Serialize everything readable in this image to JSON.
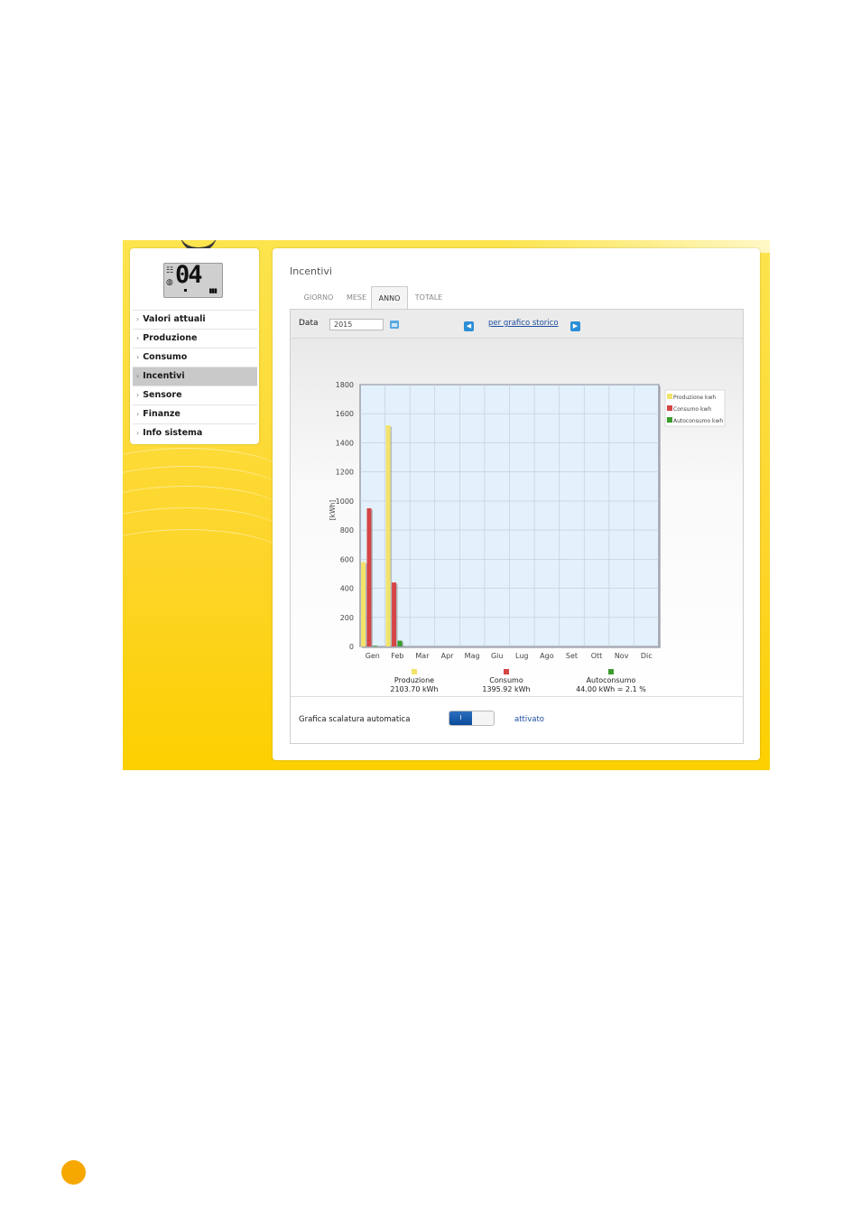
{
  "sidebar": {
    "display": {
      "digits": "04",
      "glyph_top": "☷",
      "glyph_bottom": "◍",
      "bars": "▮▮▮"
    },
    "items": [
      {
        "label": "Valori attuali",
        "active": false
      },
      {
        "label": "Produzione",
        "active": false
      },
      {
        "label": "Consumo",
        "active": false
      },
      {
        "label": "Incentivi",
        "active": true
      },
      {
        "label": "Sensore",
        "active": false
      },
      {
        "label": "Finanze",
        "active": false
      },
      {
        "label": "Info sistema",
        "active": false
      }
    ]
  },
  "main": {
    "title": "Incentivi",
    "tabs": [
      {
        "label": "GIORNO",
        "active": false
      },
      {
        "label": "MESE",
        "active": false
      },
      {
        "label": "ANNO",
        "active": true
      },
      {
        "label": "TOTALE",
        "active": false
      }
    ],
    "toolbar": {
      "date_label": "Data",
      "date_value": "2015",
      "calendar_icon": "calendar-icon",
      "prev_icon": "arrow-left-icon",
      "next_icon": "arrow-right-icon",
      "history_link": "per grafico storico"
    },
    "summary": [
      {
        "name": "Produzione",
        "value": "2103.70 kWh",
        "color": "#f2e36a"
      },
      {
        "name": "Consumo",
        "value": "1395.92 kWh",
        "color": "#d64545"
      },
      {
        "name": "Autoconsumo",
        "value": "44.00 kWh = 2.1 %",
        "color": "#3c9b2e"
      }
    ],
    "auto_scale": {
      "label": "Grafica scalatura automatica",
      "toggle_on_text": "I",
      "status": "attivato"
    }
  },
  "chart_data": {
    "type": "bar",
    "ylabel": "[kWh]",
    "ylim": [
      0,
      1800
    ],
    "yticks": [
      0,
      200,
      400,
      600,
      800,
      1000,
      1200,
      1400,
      1600,
      1800
    ],
    "categories": [
      "Gen",
      "Feb",
      "Mar",
      "Apr",
      "Mag",
      "Giu",
      "Lug",
      "Ago",
      "Set",
      "Ott",
      "Nov",
      "Dic"
    ],
    "grid": true,
    "legend_position": "right",
    "series": [
      {
        "name": "Produzione kwh",
        "color": "#f2e36a",
        "values": [
          580,
          1520,
          0,
          0,
          0,
          0,
          0,
          0,
          0,
          0,
          0,
          0
        ]
      },
      {
        "name": "Consumo kwh",
        "color": "#d64545",
        "values": [
          950,
          440,
          0,
          0,
          0,
          0,
          0,
          0,
          0,
          0,
          0,
          0
        ]
      },
      {
        "name": "Autoconsumo kwh",
        "color": "#3c9b2e",
        "values": [
          5,
          40,
          0,
          0,
          0,
          0,
          0,
          0,
          0,
          0,
          0,
          0
        ]
      }
    ]
  }
}
